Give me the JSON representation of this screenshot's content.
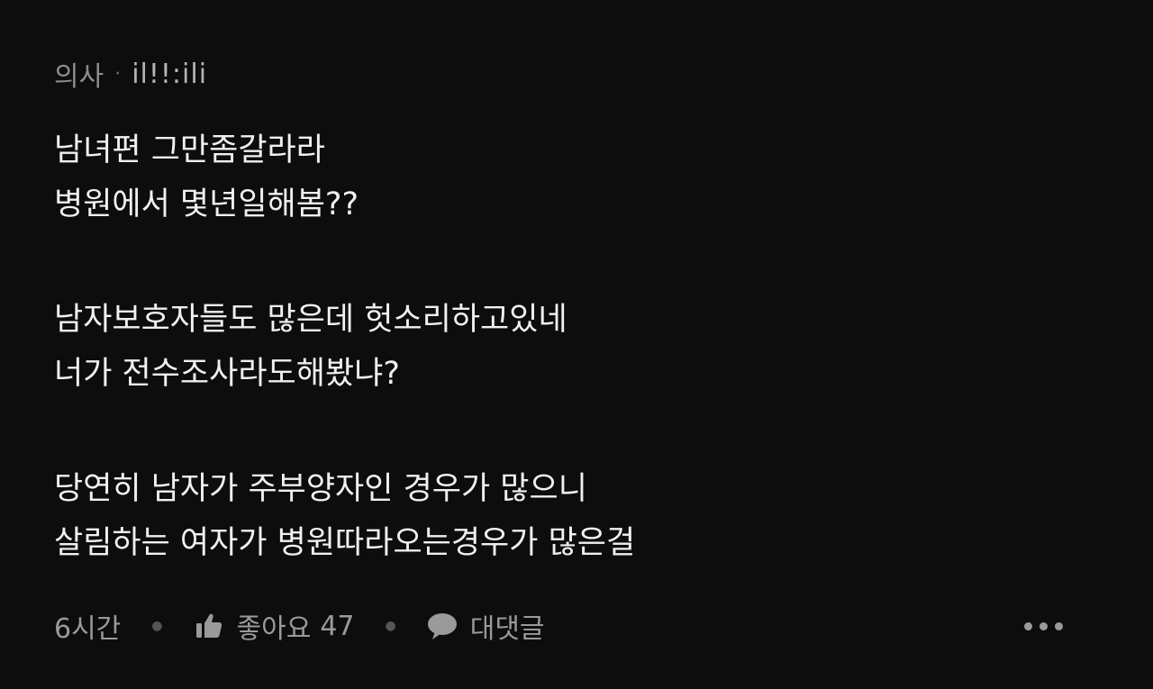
{
  "author": {
    "role": "의사",
    "separator": "·",
    "nickname": "il!!:ili"
  },
  "comment": {
    "lines": [
      "남녀편 그만좀갈라라",
      "병원에서 몇년일해봄??",
      "",
      "남자보호자들도 많은데 헛소리하고있네",
      "너가 전수조사라도해봤냐?",
      "",
      "당연히 남자가 주부양자인 경우가 많으니",
      "살림하는 여자가 병원따라오는경우가 많은걸"
    ]
  },
  "footer": {
    "time": "6시간",
    "like_label": "좋아요",
    "like_count": "47",
    "reply_label": "대댓글",
    "like_icon": "thumbs-up-icon",
    "reply_icon": "speech-bubble-icon",
    "more_icon": "more-horizontal-icon"
  },
  "colors": {
    "background": "#0d0d0d",
    "text": "#f0f0f0",
    "muted": "#9a9a9a"
  }
}
